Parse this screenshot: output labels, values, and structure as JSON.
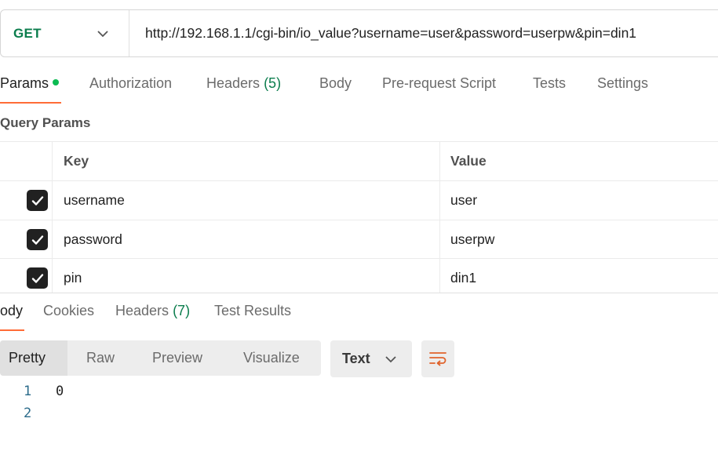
{
  "request": {
    "method": "GET",
    "url": "http://192.168.1.1/cgi-bin/io_value?username=user&password=userpw&pin=din1"
  },
  "request_tabs": [
    {
      "label": "Params",
      "active": true,
      "dot": true,
      "count": ""
    },
    {
      "label": "Authorization",
      "active": false,
      "count": ""
    },
    {
      "label": "Headers",
      "active": false,
      "count": "(5)"
    },
    {
      "label": "Body",
      "active": false,
      "count": ""
    },
    {
      "label": "Pre-request Script",
      "active": false,
      "count": ""
    },
    {
      "label": "Tests",
      "active": false,
      "count": ""
    },
    {
      "label": "Settings",
      "active": false,
      "count": ""
    }
  ],
  "query_params": {
    "title": "Query Params",
    "columns": {
      "key": "Key",
      "value": "Value"
    },
    "rows": [
      {
        "checked": true,
        "key": "username",
        "value": "user"
      },
      {
        "checked": true,
        "key": "password",
        "value": "userpw"
      },
      {
        "checked": true,
        "key": "pin",
        "value": "din1"
      }
    ]
  },
  "response_tabs": [
    {
      "label": "ody",
      "active": true,
      "count": ""
    },
    {
      "label": "Cookies",
      "active": false,
      "count": ""
    },
    {
      "label": "Headers",
      "active": false,
      "count": "(7)"
    },
    {
      "label": "Test Results",
      "active": false,
      "count": ""
    }
  ],
  "view_modes": [
    {
      "label": "Pretty",
      "active": true
    },
    {
      "label": "Raw",
      "active": false
    },
    {
      "label": "Preview",
      "active": false
    },
    {
      "label": "Visualize",
      "active": false
    }
  ],
  "format": {
    "selected": "Text"
  },
  "icons": {
    "method_dropdown": "chevron-down-icon",
    "format_dropdown": "chevron-down-icon",
    "wrap": "wrap-lines-icon",
    "checkbox": "check-icon"
  },
  "colors": {
    "accent": "#ff6c37",
    "method": "#0b7d4d",
    "dot": "#0cbb52",
    "line_number": "#2b6b8a"
  },
  "response_body": {
    "lines": [
      {
        "number": "1",
        "text": "0"
      },
      {
        "number": "2",
        "text": ""
      }
    ]
  }
}
